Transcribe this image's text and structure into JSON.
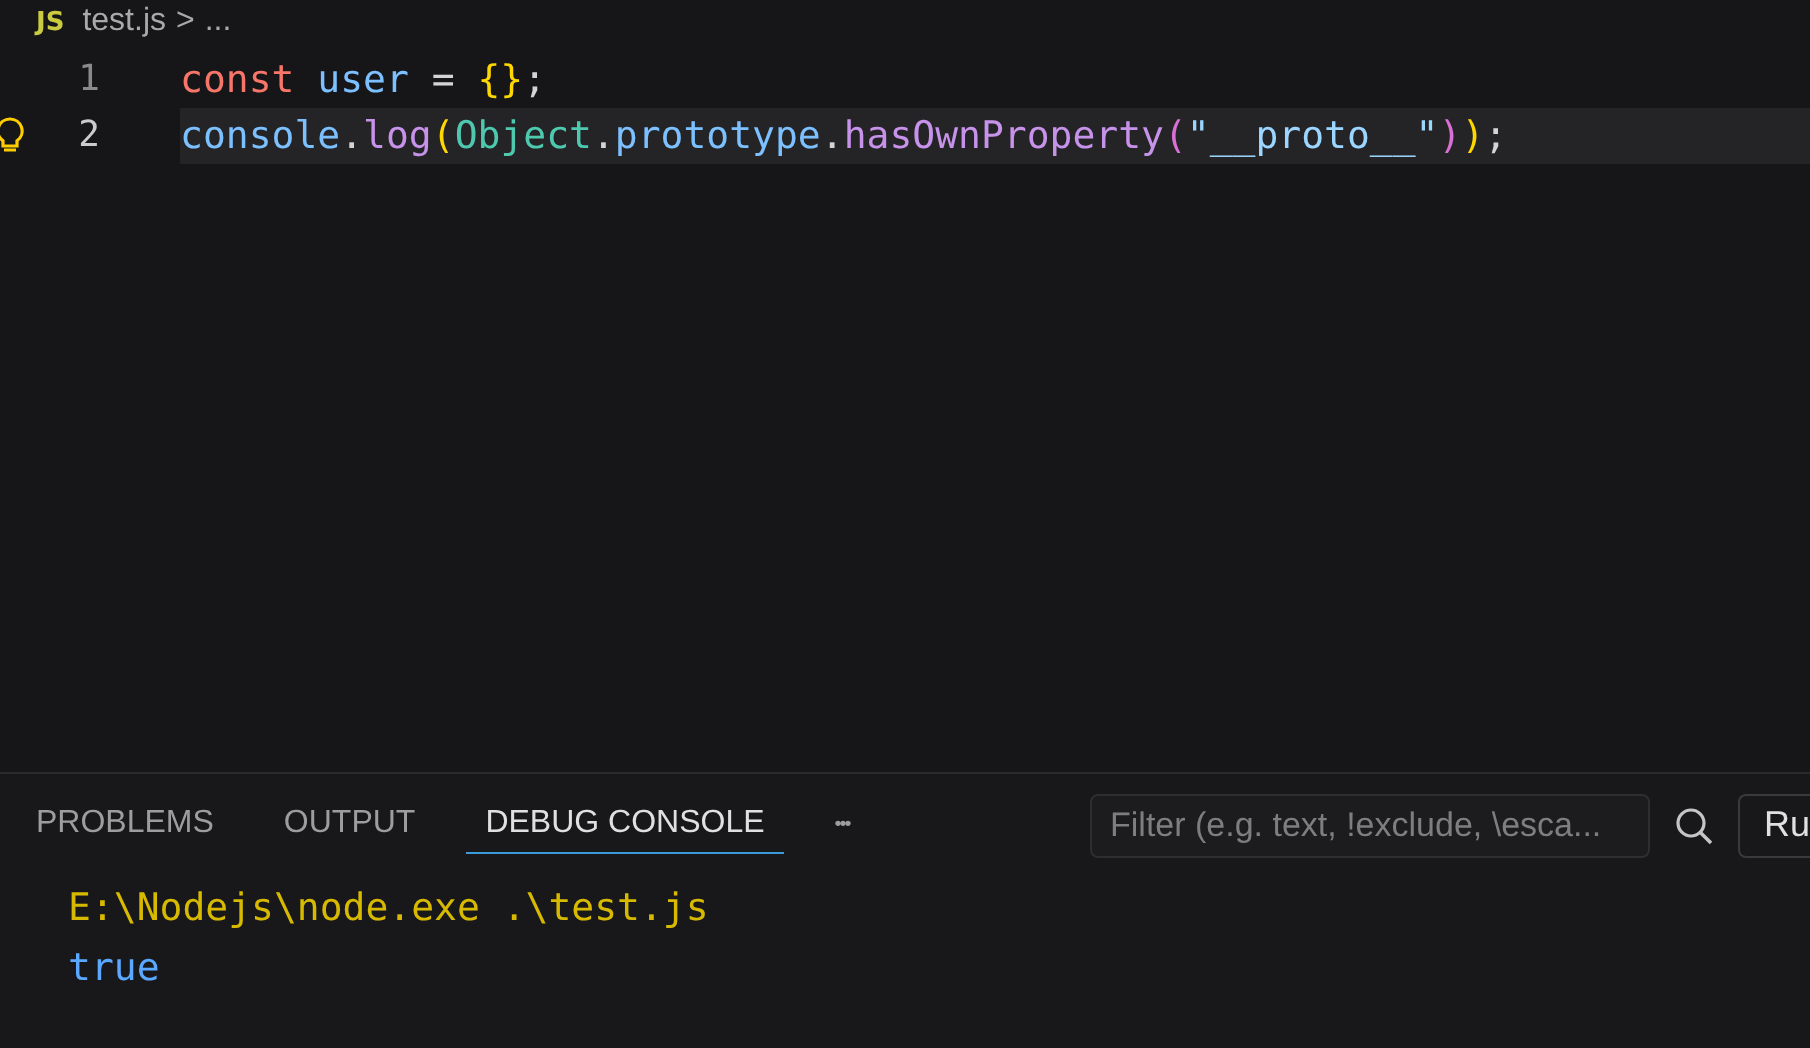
{
  "breadcrumb": {
    "badge": "JS",
    "file": "test.js",
    "separator": ">",
    "more": "..."
  },
  "editor": {
    "lines": [
      {
        "number": "1",
        "current": false,
        "lightbulb": false,
        "tokens": [
          {
            "kind": "keyword",
            "text": "const "
          },
          {
            "kind": "variable",
            "text": "user"
          },
          {
            "kind": "plain",
            "text": " = "
          },
          {
            "kind": "bracket1",
            "text": "{}"
          },
          {
            "kind": "plain",
            "text": ";"
          }
        ]
      },
      {
        "number": "2",
        "current": true,
        "lightbulb": true,
        "tokens": [
          {
            "kind": "variable",
            "text": "console"
          },
          {
            "kind": "plain",
            "text": "."
          },
          {
            "kind": "method",
            "text": "log"
          },
          {
            "kind": "bracket1",
            "text": "("
          },
          {
            "kind": "class",
            "text": "Object"
          },
          {
            "kind": "plain",
            "text": "."
          },
          {
            "kind": "variable",
            "text": "prototype"
          },
          {
            "kind": "plain",
            "text": "."
          },
          {
            "kind": "method",
            "text": "hasOwnProperty"
          },
          {
            "kind": "bracket2",
            "text": "("
          },
          {
            "kind": "string",
            "text": "\"__proto__\""
          },
          {
            "kind": "bracket2",
            "text": ")"
          },
          {
            "kind": "bracket1",
            "text": ")"
          },
          {
            "kind": "plain",
            "text": ";"
          }
        ]
      }
    ]
  },
  "panel": {
    "tabs": [
      {
        "label": "PROBLEMS",
        "selected": false
      },
      {
        "label": "OUTPUT",
        "selected": false
      },
      {
        "label": "DEBUG CONSOLE",
        "selected": true
      }
    ],
    "more": "•••",
    "filter": {
      "placeholder": "Filter (e.g. text, !exclude, \\esca..."
    },
    "dropdown": "Ru",
    "output": [
      {
        "kind": "command",
        "text": "E:\\Nodejs\\node.exe .\\test.js"
      },
      {
        "kind": "value",
        "text": "true"
      }
    ]
  }
}
